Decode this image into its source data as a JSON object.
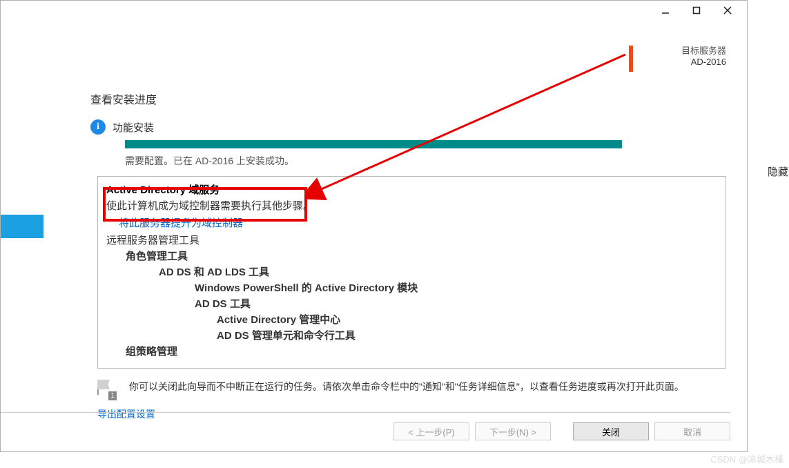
{
  "header": {
    "target_label": "目标服务器",
    "target_server": "AD-2016"
  },
  "content": {
    "view_title": "查看安装进度",
    "install_status": "功能安装",
    "config_status": "需要配置。已在 AD-2016 上安装成功。"
  },
  "results": {
    "title": "Active Directory 域服务",
    "desc": "使此计算机成为域控制器需要执行其他步骤。",
    "promote_link": "将此服务器提升为域控制器",
    "items": {
      "l1": "远程服务器管理工具",
      "l2": "角色管理工具",
      "l3": "AD DS 和 AD LDS 工具",
      "l4": "Windows PowerShell 的 Active Directory 模块",
      "l5": "AD DS 工具",
      "l6": "Active Directory 管理中心",
      "l7": "AD DS 管理单元和命令行工具",
      "l8": "组策略管理"
    }
  },
  "hint": {
    "text": "你可以关闭此向导而不中断正在运行的任务。请依次单击命令栏中的\"通知\"和\"任务详细信息\"，以查看任务进度或再次打开此页面。",
    "flag_count": "1"
  },
  "export_link": "导出配置设置",
  "buttons": {
    "prev": "< 上一步(P)",
    "next": "下一步(N) >",
    "close": "关闭",
    "cancel": "取消"
  },
  "side_text": "隐藏",
  "watermark": "CSDN @凉城木槿"
}
